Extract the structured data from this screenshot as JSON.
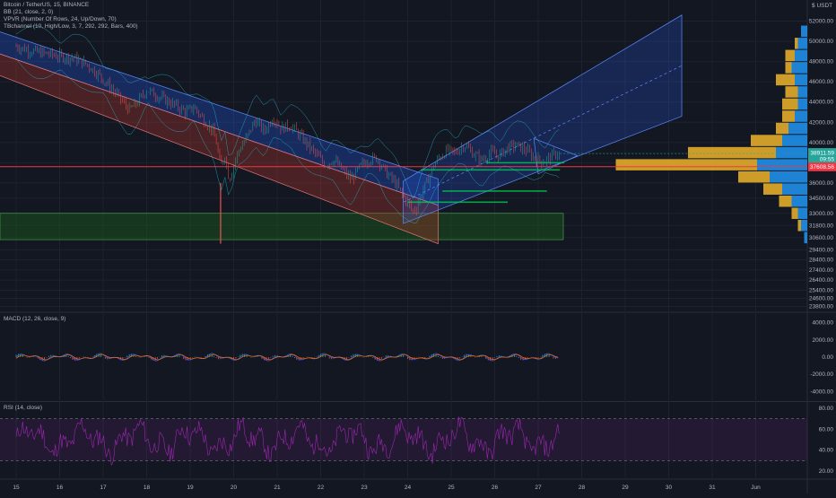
{
  "header": {
    "symbol_line": "Bitcoin / TetherUS, 15, BINANCE",
    "indicators": [
      "BB (21, close, 2, 0)",
      "VPVR (Number Of Rows, 24, Up/Down, 70)",
      "TBchannel (10, High/Low, 3, 7, 292, 292, Bars, 400)"
    ],
    "currency": "USDT",
    "currency_icon": "dollar-icon"
  },
  "colors": {
    "background": "#131722",
    "grid": "#1e222d",
    "candle_up": "#26a69a",
    "candle_down": "#ef5350",
    "channel_blue": "#2962ff",
    "channel_red": "#c0392b",
    "support_zone": "#1b5e20",
    "vp_up": "#2196f3",
    "vp_down": "#f0b429",
    "price_line": "#f23645",
    "macd": "#2962ff",
    "signal": "#ff6d00",
    "rsi": "#9c27b0"
  },
  "chart_data": [
    {
      "type": "candlestick",
      "pane": "price",
      "x_ticks": [
        "15",
        "16",
        "17",
        "18",
        "19",
        "20",
        "21",
        "22",
        "23",
        "24",
        "25",
        "26",
        "27",
        "28",
        "29",
        "30",
        "31",
        "Jun"
      ],
      "y_ticks": [
        "52000.00",
        "50000.00",
        "48000.00",
        "46000.00",
        "44000.00",
        "42000.00",
        "40000.00",
        "38000.00",
        "36000.00",
        "34500.00",
        "33000.00",
        "31800.00",
        "30600.00",
        "29400.00",
        "28400.00",
        "27400.00",
        "26400.00",
        "25400.00",
        "24600.00",
        "23800.00"
      ],
      "ylim": [
        23400,
        53200
      ],
      "close_path": [
        [
          0,
          49500
        ],
        [
          0.4,
          49000
        ],
        [
          0.8,
          48700
        ],
        [
          1.0,
          48500
        ],
        [
          1.3,
          48400
        ],
        [
          1.6,
          47800
        ],
        [
          1.9,
          46700
        ],
        [
          2.2,
          45300
        ],
        [
          2.4,
          44300
        ],
        [
          2.6,
          43200
        ],
        [
          2.8,
          44000
        ],
        [
          3.0,
          45200
        ],
        [
          3.3,
          44500
        ],
        [
          3.6,
          43800
        ],
        [
          3.9,
          43000
        ],
        [
          4.1,
          43500
        ],
        [
          4.3,
          42300
        ],
        [
          4.5,
          41300
        ],
        [
          4.6,
          40000
        ],
        [
          4.7,
          37500
        ],
        [
          4.8,
          38800
        ],
        [
          4.9,
          36300
        ],
        [
          5.0,
          37800
        ],
        [
          5.1,
          39100
        ],
        [
          5.3,
          40500
        ],
        [
          5.5,
          42200
        ],
        [
          5.7,
          41100
        ],
        [
          5.9,
          42500
        ],
        [
          6.1,
          41400
        ],
        [
          6.3,
          41700
        ],
        [
          6.5,
          40800
        ],
        [
          6.7,
          39800
        ],
        [
          6.9,
          38800
        ],
        [
          7.1,
          37800
        ],
        [
          7.3,
          38300
        ],
        [
          7.5,
          37300
        ],
        [
          7.7,
          36300
        ],
        [
          7.9,
          37600
        ],
        [
          8.1,
          38300
        ],
        [
          8.3,
          38500
        ],
        [
          8.5,
          37000
        ],
        [
          8.7,
          36100
        ],
        [
          8.9,
          34700
        ],
        [
          9.0,
          34100
        ],
        [
          9.1,
          33200
        ],
        [
          9.2,
          33600
        ],
        [
          9.3,
          34800
        ],
        [
          9.4,
          35700
        ],
        [
          9.5,
          36600
        ],
        [
          9.6,
          37700
        ],
        [
          9.7,
          38400
        ],
        [
          9.9,
          39200
        ],
        [
          10.1,
          39000
        ],
        [
          10.3,
          39800
        ],
        [
          10.5,
          38900
        ],
        [
          10.7,
          38200
        ],
        [
          10.9,
          39000
        ],
        [
          11.1,
          38700
        ],
        [
          11.3,
          39500
        ],
        [
          11.5,
          39700
        ],
        [
          11.7,
          39300
        ],
        [
          11.9,
          38500
        ],
        [
          12.1,
          38100
        ],
        [
          12.3,
          38600
        ],
        [
          12.4,
          38900
        ],
        [
          12.5,
          38900
        ]
      ]
    },
    {
      "type": "volume_profile",
      "pane": "price",
      "y_ticks_ref": "price",
      "rows": [
        {
          "price": 51000,
          "up": 2,
          "down": 0
        },
        {
          "price": 49800,
          "up": 3,
          "down": 1
        },
        {
          "price": 48600,
          "up": 4,
          "down": 3
        },
        {
          "price": 47400,
          "up": 5,
          "down": 2
        },
        {
          "price": 46200,
          "up": 4,
          "down": 6
        },
        {
          "price": 45000,
          "up": 3,
          "down": 4
        },
        {
          "price": 43800,
          "up": 3,
          "down": 5
        },
        {
          "price": 42600,
          "up": 4,
          "down": 4
        },
        {
          "price": 41400,
          "up": 6,
          "down": 4
        },
        {
          "price": 40200,
          "up": 8,
          "down": 10
        },
        {
          "price": 39000,
          "up": 10,
          "down": 28
        },
        {
          "price": 37800,
          "up": 16,
          "down": 45
        },
        {
          "price": 36600,
          "up": 12,
          "down": 10
        },
        {
          "price": 35400,
          "up": 8,
          "down": 6
        },
        {
          "price": 34200,
          "up": 5,
          "down": 4
        },
        {
          "price": 33000,
          "up": 3,
          "down": 2
        },
        {
          "price": 31800,
          "up": 2,
          "down": 1
        },
        {
          "price": 30600,
          "up": 1,
          "down": 0
        }
      ]
    },
    {
      "type": "line",
      "pane": "macd",
      "title": "MACD (12, 26, close, 9)",
      "y_ticks": [
        "4000.00",
        "2000.00",
        "0.00",
        "-2000.00",
        "-4000.00"
      ],
      "ylim": [
        -5000,
        5000
      ],
      "series": [
        {
          "name": "MACD",
          "values_note": "oscillates near 0"
        },
        {
          "name": "Signal",
          "values_note": "oscillates near 0"
        }
      ]
    },
    {
      "type": "line",
      "pane": "rsi",
      "title": "RSI (14, close)",
      "y_ticks": [
        "80.00",
        "60.00",
        "40.00",
        "20.00"
      ],
      "ylim": [
        15,
        85
      ],
      "bands": [
        70,
        30
      ]
    }
  ],
  "price_badges": {
    "current": "38911.59",
    "countdown": "09:55",
    "marked": "37608.56"
  },
  "timescale_ticks": [
    "15",
    "16",
    "17",
    "18",
    "19",
    "20",
    "21",
    "22",
    "23",
    "24",
    "25",
    "26",
    "27",
    "28",
    "29",
    "30",
    "31",
    "Jun"
  ],
  "panes": {
    "macd_label": "MACD (12, 26, close, 9)",
    "rsi_label": "RSI (14, close)"
  }
}
